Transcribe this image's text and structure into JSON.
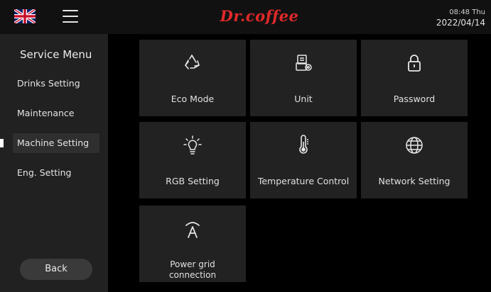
{
  "header": {
    "logo_text": "Dr.coffee",
    "time": "08:48 Thu",
    "date": "2022/04/14",
    "language_flag": "uk-flag-icon"
  },
  "sidebar": {
    "title": "Service Menu",
    "items": [
      {
        "label": "Drinks Setting",
        "active": false
      },
      {
        "label": "Maintenance",
        "active": false
      },
      {
        "label": "Machine Setting",
        "active": true
      },
      {
        "label": "Eng. Setting",
        "active": false
      }
    ],
    "back_label": "Back"
  },
  "tiles": [
    {
      "label": "Eco Mode",
      "icon": "recycle-icon"
    },
    {
      "label": "Unit",
      "icon": "unit-icon"
    },
    {
      "label": "Password",
      "icon": "lock-icon"
    },
    {
      "label": "RGB Setting",
      "icon": "bulb-icon"
    },
    {
      "label": "Temperature Control",
      "icon": "thermometer-icon"
    },
    {
      "label": "Network Setting",
      "icon": "globe-icon"
    },
    {
      "label": "Power grid connection",
      "icon": "power-grid-icon"
    }
  ],
  "colors": {
    "brand": "#e02a2a",
    "tile": "#222222",
    "sidebar": "#212121"
  }
}
